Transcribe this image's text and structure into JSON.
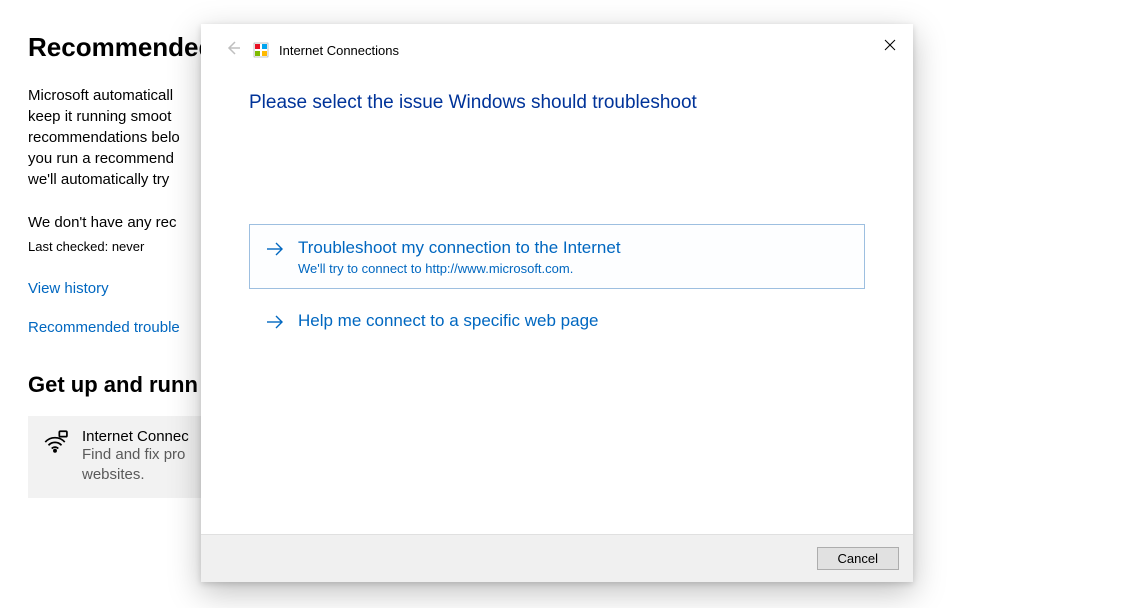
{
  "bg": {
    "heading": "Recommended t",
    "body": "Microsoft automaticall\nkeep it running smoot\nrecommendations belo\nyou run a recommend\nwe'll automatically try",
    "norec": "We don't have any rec",
    "lastchecked": "Last checked: never",
    "link_history": "View history",
    "link_recommended": "Recommended trouble",
    "heading2": "Get up and runn",
    "tile": {
      "title": "Internet Connec",
      "desc": "Find and fix pro\nwebsites."
    }
  },
  "dialog": {
    "breadcrumb": "Internet Connections",
    "title": "Please select the issue Windows should troubleshoot",
    "options": [
      {
        "title": "Troubleshoot my connection to the Internet",
        "desc": "We'll try to connect to http://www.microsoft.com."
      },
      {
        "title": "Help me connect to a specific web page",
        "desc": ""
      }
    ],
    "cancel": "Cancel"
  }
}
